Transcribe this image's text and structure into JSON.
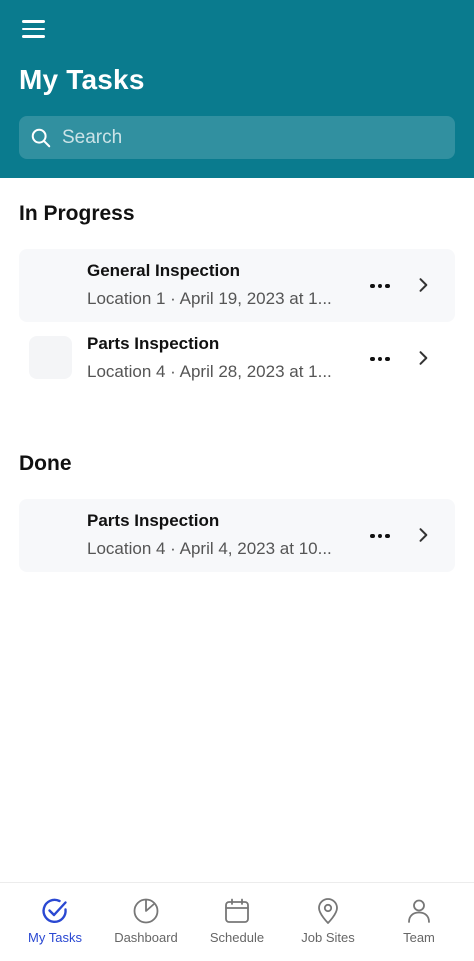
{
  "header": {
    "title": "My Tasks",
    "search_placeholder": "Search"
  },
  "sections": [
    {
      "title": "In Progress",
      "tasks": [
        {
          "title": "General Inspection",
          "subtitle": "Location 1 · April 19, 2023 at 1..."
        },
        {
          "title": "Parts Inspection",
          "subtitle": "Location 4 · April 28, 2023 at 1..."
        }
      ]
    },
    {
      "title": "Done",
      "tasks": [
        {
          "title": "Parts Inspection",
          "subtitle": "Location 4 · April 4, 2023 at 10..."
        }
      ]
    }
  ],
  "tabbar": {
    "tabs": [
      {
        "label": "My Tasks",
        "icon": "check-circle-icon",
        "active": true
      },
      {
        "label": "Dashboard",
        "icon": "pie-chart-icon"
      },
      {
        "label": "Schedule",
        "icon": "calendar-icon"
      },
      {
        "label": "Job Sites",
        "icon": "map-pin-icon"
      },
      {
        "label": "Team",
        "icon": "person-icon"
      }
    ]
  },
  "colors": {
    "header_bg": "#0a7b8e",
    "active_tab": "#2a48d2",
    "inactive_tab": "#666666",
    "card_bg": "#f7f8fa"
  }
}
